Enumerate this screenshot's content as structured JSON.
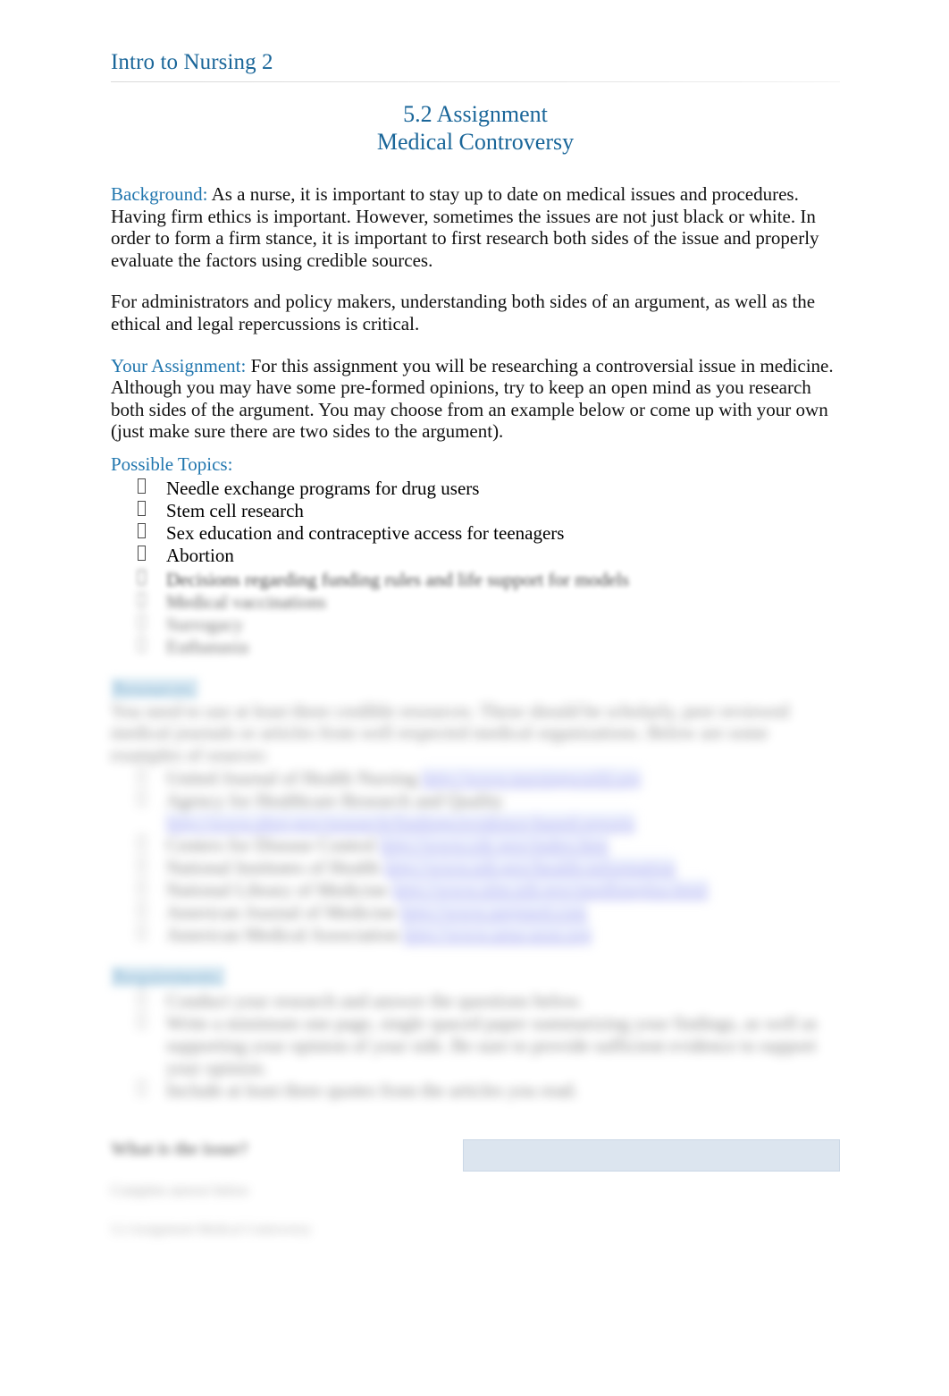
{
  "document": {
    "course_header": "Intro to Nursing 2",
    "title_line_1": "5.2 Assignment",
    "title_line_2": "Medical Controversy"
  },
  "background": {
    "label": "Background:",
    "text": "As a nurse, it is important to stay up to date on medical issues and procedures.    Having firm ethics is important.     However, sometimes the issues are not just black or white.    In order to form a firm stance, it is important to first research both sides of the issue and properly evaluate the factors using credible sources.",
    "paragraph_2": "For administrators and policy makers, understanding both sides of an argument, as well as the ethical and legal repercussions is critical."
  },
  "assignment": {
    "label": "Your Assignment:",
    "text": "For this assignment you will be researching a controversial issue in medicine.   Although you may have some pre-formed opinions, try to keep an open mind as you research both sides of the argument.        You may choose from an example below or come up with your own (just make sure there are two sides to the argument)."
  },
  "possible_topics": {
    "label": "Possible Topics:",
    "items": [
      "Needle exchange programs for drug users",
      "Stem cell research",
      "Sex education and contraceptive access for teenagers",
      "Abortion"
    ],
    "redacted_items": [
      "Decisions regarding funding rules and life support for models",
      "Medical vaccinations",
      "Surrogacy",
      "Euthanasia"
    ]
  },
  "resources": {
    "label": "Resources:",
    "intro": "You need to use at least three credible resources. These should be scholarly, peer reviewed medical journals or articles from well respected medical organizations. Below are some examples of sources:",
    "items": [
      {
        "name": "United Journal of Health Nursing",
        "link": "http://www.nursingworld.org"
      },
      {
        "name": "Agency for Healthcare Research and Quality",
        "link": "http://www.ahrq.gov/research/findings/evidence-based-reports"
      },
      {
        "name": "Centers for Disease Control",
        "link": "http://www.cdc.gov/index.htm"
      },
      {
        "name": "National Institutes of Health",
        "link": "http://www.nih.gov/health-information"
      },
      {
        "name": "National Library of Medicine",
        "link": "http://www.nlm.nih.gov/medlineplus.html"
      },
      {
        "name": "American Journal of Medicine",
        "link": "http://www.amjmed.com"
      },
      {
        "name": "American Medical Association",
        "link": "http://www.ama-assn.org"
      }
    ]
  },
  "requirements": {
    "label": "Requirements:",
    "items": [
      "Conduct your research and answer the questions below.",
      "Write a minimum one page, single spaced paper summarizing your findings, as well as supporting your opinion of your side. Be sure to provide sufficient evidence to support your opinion.",
      "Include at least three quotes from the articles you read."
    ]
  },
  "bottom": {
    "prompt": "What is the issue?",
    "answer_placeholder": "",
    "caption": "Complete answer below",
    "footer": "5.2 Assignment Medical Controversy"
  },
  "colors": {
    "heading_blue": "#1A6699",
    "label_blue": "#2176AE",
    "highlight_blue": "#BDD9EA",
    "link_purple": "#6F6CE6",
    "answer_box": "#DCE5EF"
  }
}
